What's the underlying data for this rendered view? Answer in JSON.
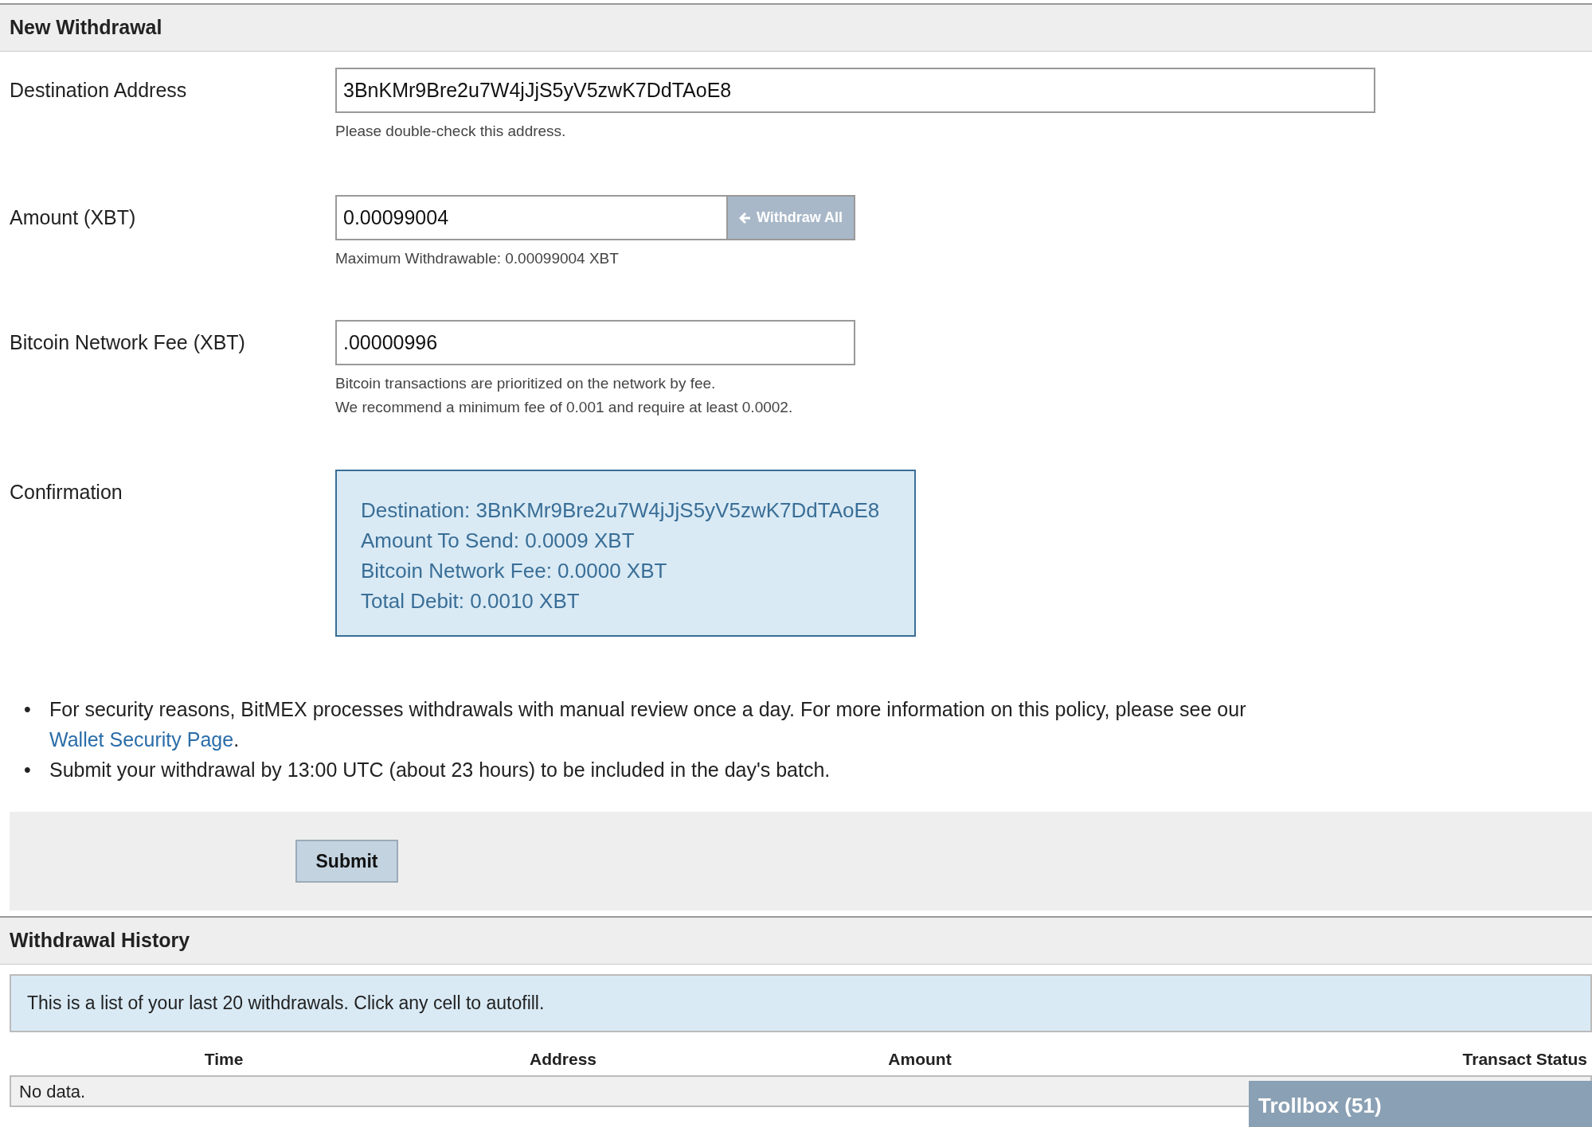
{
  "form": {
    "title": "New Withdrawal",
    "fields": [
      {
        "kind": "text",
        "label": "Destination Address",
        "value": "3BnKMr9Bre2u7W4jJjS5yV5zwK7DdTAoE8",
        "help": [
          "Please double-check this address."
        ]
      },
      {
        "kind": "addon",
        "label": "Amount (XBT)",
        "value": "0.00099004",
        "button": "Withdraw All",
        "help": [
          "Maximum Withdrawable: 0.00099004 XBT"
        ]
      },
      {
        "kind": "short",
        "label": "Bitcoin Network Fee (XBT)",
        "value": ".00000996",
        "help": [
          "Bitcoin transactions are prioritized on the network by fee.",
          "We recommend a minimum fee of 0.001 and require at least 0.0002."
        ]
      },
      {
        "kind": "summary",
        "label": "Confirmation",
        "lines": [
          "Destination: 3BnKMr9Bre2u7W4jJjS5yV5zwK7DdTAoE8",
          "Amount To Send: 0.0009 XBT",
          "Bitcoin Network Fee: 0.0000 XBT",
          "Total Debit: 0.0010 XBT"
        ]
      }
    ],
    "notes": [
      {
        "bullet": "•",
        "text": "For security reasons, BitMEX processes withdrawals with manual review once a day. For more information on this policy, please see our ",
        "link": "Wallet Security Page",
        "after": "."
      },
      {
        "bullet": "•",
        "text": "Submit your withdrawal by 13:00 UTC (about 23 hours) to be included in the day's batch."
      }
    ],
    "submit": "Submit"
  },
  "history": {
    "title": "Withdrawal History",
    "info": "This is a list of your last 20 withdrawals. Click any cell to autofill.",
    "columns": [
      "Time",
      "Address",
      "Amount",
      "Transact Status"
    ],
    "empty": "No data."
  },
  "trollbox": {
    "label": "Trollbox (51)"
  }
}
